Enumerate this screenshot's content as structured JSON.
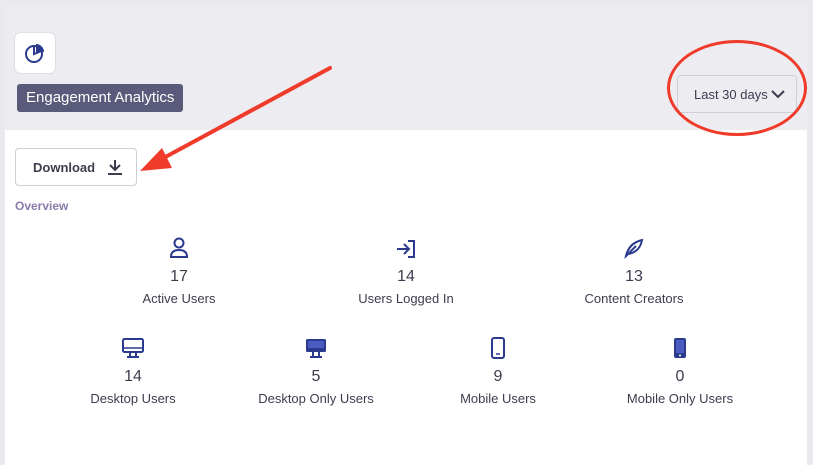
{
  "header": {
    "title": "Engagement Analytics",
    "app_icon": "pie-chart-icon",
    "range": {
      "selected": "Last 30 days",
      "icon": "chevron-down-icon"
    }
  },
  "actions": {
    "download_label": "Download",
    "download_icon": "download-icon"
  },
  "overview": {
    "label": "Overview",
    "stats": [
      {
        "value": "17",
        "label": "Active Users",
        "icon": "user-icon"
      },
      {
        "value": "14",
        "label": "Users Logged In",
        "icon": "login-icon"
      },
      {
        "value": "13",
        "label": "Content Creators",
        "icon": "feather-icon"
      },
      {
        "value": "14",
        "label": "Desktop Users",
        "icon": "desktop-icon"
      },
      {
        "value": "5",
        "label": "Desktop Only Users",
        "icon": "desktop-filled-icon"
      },
      {
        "value": "9",
        "label": "Mobile Users",
        "icon": "mobile-icon"
      },
      {
        "value": "0",
        "label": "Mobile Only Users",
        "icon": "mobile-filled-icon"
      }
    ]
  },
  "colors": {
    "accent": "#2b3a8f",
    "badge_bg": "#5a5a7a",
    "annotation_red": "#f03a2a"
  }
}
